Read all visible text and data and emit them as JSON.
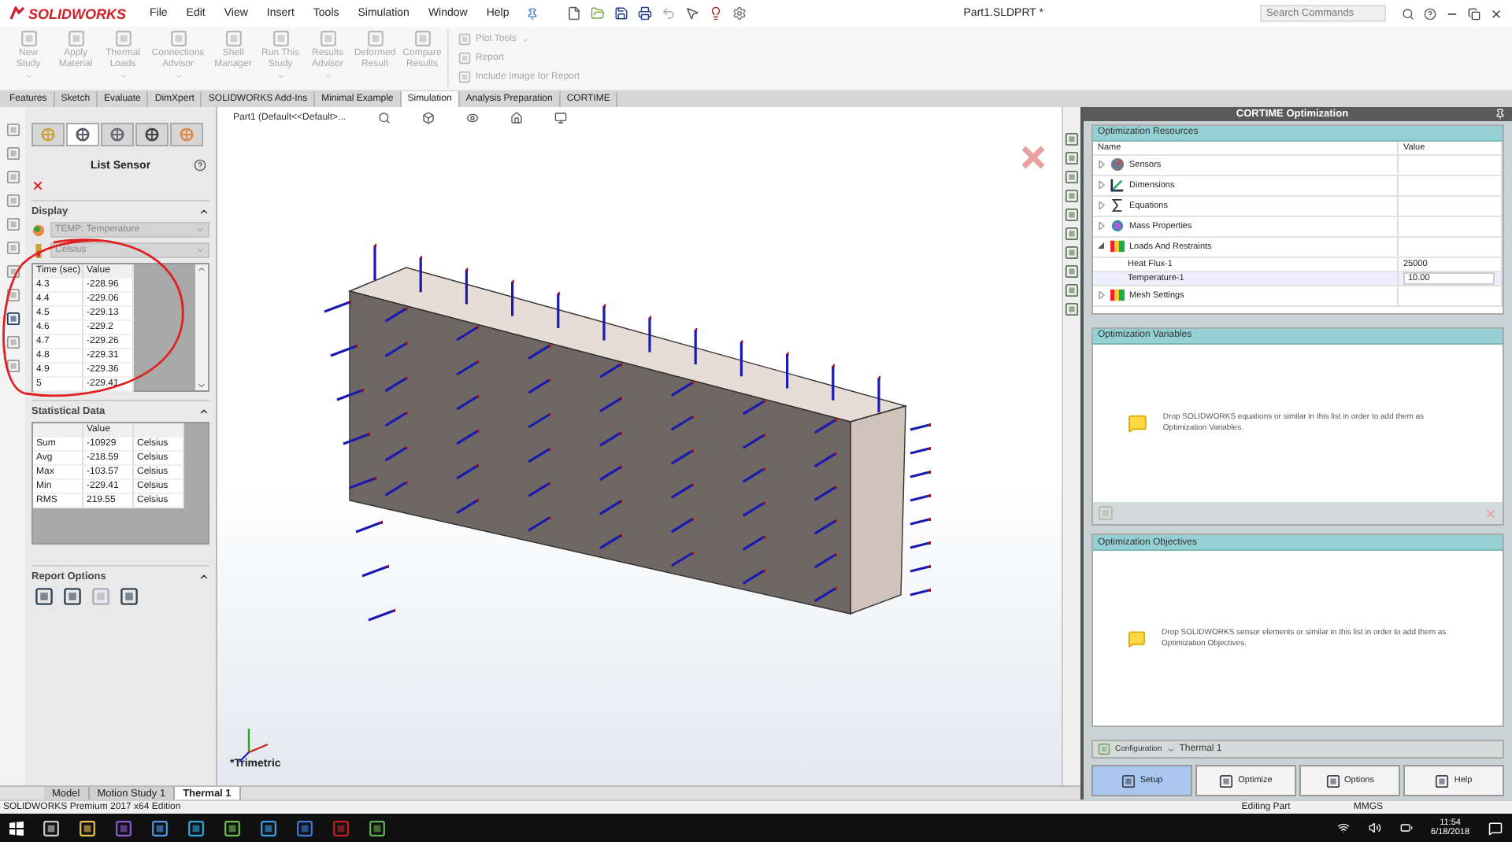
{
  "window": {
    "title": "Part1.SLDPRT *"
  },
  "logo": "SOLIDWORKS",
  "menus": [
    "File",
    "Edit",
    "View",
    "Insert",
    "Tools",
    "Simulation",
    "Window",
    "Help"
  ],
  "search": {
    "placeholder": "Search Commands"
  },
  "ribbon": [
    {
      "kind": "large",
      "label": "New Study",
      "disabled": true,
      "dropdown": true
    },
    {
      "kind": "large",
      "label": "Apply Material",
      "disabled": true,
      "dropdown": false
    },
    {
      "kind": "large",
      "label": "Thermal Loads",
      "disabled": true,
      "dropdown": true
    },
    {
      "kind": "large",
      "label": "Connections Advisor",
      "disabled": true,
      "dropdown": true
    },
    {
      "kind": "large",
      "label": "Shell Manager",
      "disabled": true,
      "dropdown": false
    },
    {
      "kind": "large",
      "label": "Run This Study",
      "disabled": true,
      "dropdown": true
    },
    {
      "kind": "large",
      "label": "Results Advisor",
      "disabled": true,
      "dropdown": true
    },
    {
      "kind": "large",
      "label": "Deformed Result",
      "disabled": true,
      "dropdown": false
    },
    {
      "kind": "large",
      "label": "Compare Results",
      "disabled": true,
      "dropdown": false
    },
    {
      "kind": "small",
      "label": "Plot Tools",
      "disabled": true,
      "dropdown": true
    },
    {
      "kind": "small",
      "label": "Report",
      "disabled": true,
      "dropdown": false
    },
    {
      "kind": "small",
      "label": "Include Image for Report",
      "disabled": true,
      "dropdown": false
    }
  ],
  "command_tabs": [
    {
      "label": "Features",
      "selected": false
    },
    {
      "label": "Sketch",
      "selected": false
    },
    {
      "label": "Evaluate",
      "selected": false
    },
    {
      "label": "DimXpert",
      "selected": false
    },
    {
      "label": "SOLIDWORKS Add-Ins",
      "selected": false
    },
    {
      "label": "Minimal Example",
      "selected": false
    },
    {
      "label": "Simulation",
      "selected": true
    },
    {
      "label": "Analysis Preparation",
      "selected": false
    },
    {
      "label": "CORTIME",
      "selected": false
    }
  ],
  "left_panel": {
    "tabs": [
      {
        "kind": "feature",
        "selected": false
      },
      {
        "kind": "property",
        "selected": true
      },
      {
        "kind": "config",
        "selected": false
      },
      {
        "kind": "dimxpert",
        "selected": false
      },
      {
        "kind": "display",
        "selected": false
      }
    ],
    "title": "List Sensor",
    "display_title": "Display",
    "quantity": "TEMP: Temperature",
    "unit": "Celsius",
    "time_table": {
      "columns": [
        "Time (sec)",
        "Value"
      ],
      "rows": [
        [
          "4.3",
          "-228.96"
        ],
        [
          "4.4",
          "-229.06"
        ],
        [
          "4.5",
          "-229.13"
        ],
        [
          "4.6",
          "-229.2"
        ],
        [
          "4.7",
          "-229.26"
        ],
        [
          "4.8",
          "-229.31"
        ],
        [
          "4.9",
          "-229.36"
        ],
        [
          "5",
          "-229.41"
        ]
      ]
    },
    "stats": {
      "title": "Statistical Data",
      "columns": [
        "",
        "Value",
        ""
      ],
      "rows": [
        [
          "Sum",
          "-10929",
          "Celsius"
        ],
        [
          "Avg",
          "-218.59",
          "Celsius"
        ],
        [
          "Max",
          "-103.57",
          "Celsius"
        ],
        [
          "Min",
          "-229.41",
          "Celsius"
        ],
        [
          "RMS",
          "219.55",
          "Celsius"
        ]
      ]
    },
    "report_title": "Report Options"
  },
  "viewport": {
    "breadcrumb": "Part1 (Default<<Default>...",
    "view_label": "*Trimetric"
  },
  "bottom_tabs": [
    {
      "label": "Model",
      "selected": false
    },
    {
      "label": "Motion Study 1",
      "selected": false
    },
    {
      "label": "Thermal 1",
      "selected": true
    }
  ],
  "optimization": {
    "title": "CORTIME Optimization",
    "resources": {
      "title": "Optimization Resources",
      "columns": [
        "Name",
        "Value"
      ],
      "items": [
        {
          "kind": "sensor",
          "name": "Sensors",
          "expanded": false
        },
        {
          "kind": "dimension",
          "name": "Dimensions",
          "expanded": false
        },
        {
          "kind": "equation",
          "name": "Equations",
          "expanded": false
        },
        {
          "kind": "mass",
          "name": "Mass Properties",
          "expanded": false
        },
        {
          "kind": "loads",
          "name": "Loads And Restraints",
          "expanded": true,
          "children": [
            {
              "name": "Heat Flux-1",
              "value": "25000",
              "selected": false
            },
            {
              "name": "Temperature-1",
              "value": "10.00",
              "selected": true
            }
          ]
        },
        {
          "kind": "loads",
          "name": "Mesh Settings",
          "expanded": false
        }
      ]
    },
    "variables": {
      "title": "Optimization Variables",
      "message": "Drop SOLIDWORKS equations or similar in this list in order to add them as Optimization Variables."
    },
    "objectives": {
      "title": "Optimization Objectives",
      "message": "Drop SOLIDWORKS sensor elements or similar in this list in order to add them as Optimization Objectives."
    },
    "configuration": {
      "label": "Configuration",
      "value": "Thermal 1"
    },
    "buttons": [
      {
        "label": "Setup",
        "selected": true
      },
      {
        "label": "Optimize",
        "selected": false
      },
      {
        "label": "Options",
        "selected": false
      },
      {
        "label": "Help",
        "selected": false
      }
    ]
  },
  "status_bar": {
    "product": "SOLIDWORKS Premium 2017 x64 Edition",
    "mode": "Editing Part",
    "units": "MMGS"
  },
  "taskbar": {
    "time": "11:54",
    "date": "6/18/2018"
  }
}
